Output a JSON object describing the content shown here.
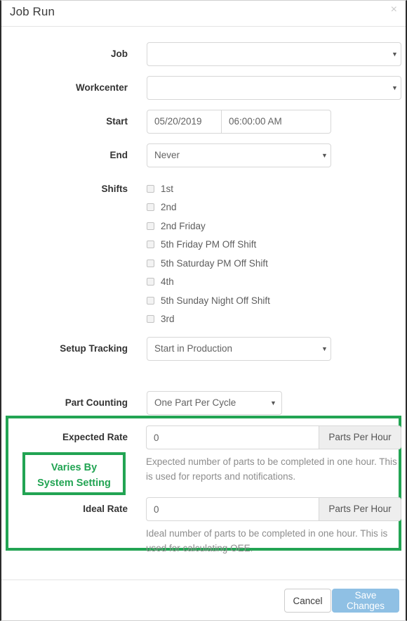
{
  "modal": {
    "title": "Job Run",
    "close_icon": "×"
  },
  "accent": {
    "highlight_green": "#22a453",
    "save_button_blue": "#8fc0e4"
  },
  "fields": {
    "job": {
      "label": "Job",
      "value": "",
      "placeholder": ""
    },
    "workcenter": {
      "label": "Workcenter",
      "value": "",
      "placeholder": ""
    },
    "start": {
      "label": "Start",
      "date": "05/20/2019",
      "time": "06:00:00 AM"
    },
    "end": {
      "label": "End",
      "value": "Never",
      "options": [
        "Never"
      ]
    },
    "shifts": {
      "label": "Shifts",
      "items": [
        {
          "label": "1st",
          "checked": false
        },
        {
          "label": "2nd",
          "checked": false
        },
        {
          "label": "2nd Friday",
          "checked": false
        },
        {
          "label": "5th Friday PM Off Shift",
          "checked": false
        },
        {
          "label": "5th Saturday PM Off Shift",
          "checked": false
        },
        {
          "label": "4th",
          "checked": false
        },
        {
          "label": "5th Sunday Night Off Shift",
          "checked": false
        },
        {
          "label": "3rd",
          "checked": false
        }
      ]
    },
    "setup_tracking": {
      "label": "Setup Tracking",
      "value": "Start in Production",
      "options": [
        "Start in Production"
      ]
    },
    "part_counting": {
      "label": "Part Counting",
      "value": "One Part Per Cycle",
      "options": [
        "One Part Per Cycle"
      ]
    },
    "expected_rate": {
      "label": "Expected Rate",
      "value": "0",
      "addon": "Parts Per Hour",
      "help": "Expected number of parts to be completed in one hour. This is used for reports and notifications."
    },
    "ideal_rate": {
      "label": "Ideal Rate",
      "value": "0",
      "addon": "Parts Per Hour",
      "help": "Ideal number of parts to be completed in one hour. This is used for calculating OEE."
    }
  },
  "annotation": {
    "note_line_1": "Varies By",
    "note_line_2": "System Setting"
  },
  "footer": {
    "cancel_label": "Cancel",
    "save_label": "Save Changes"
  },
  "icons": {
    "caret_down": "▼"
  }
}
